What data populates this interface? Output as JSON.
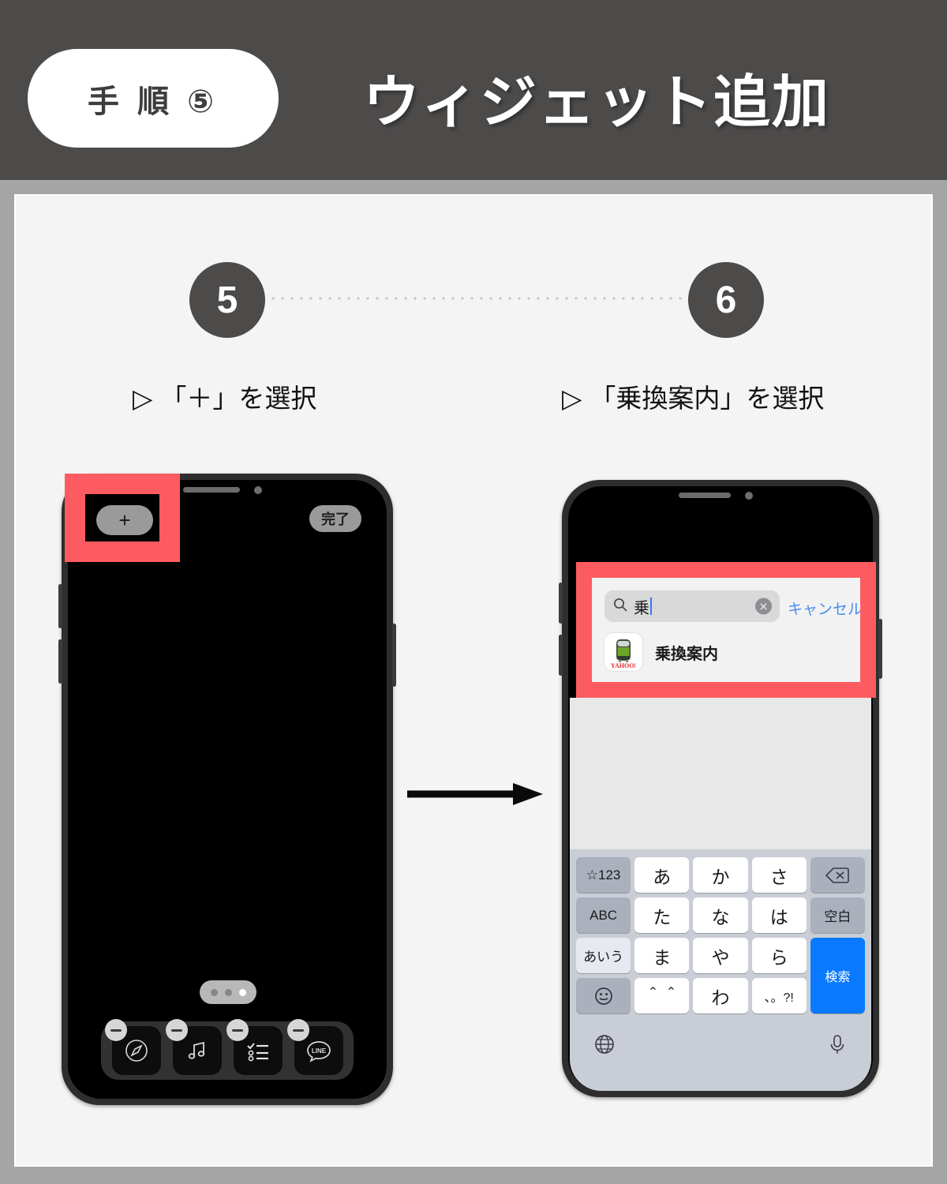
{
  "header": {
    "step_badge": "手 順 ⑤",
    "title": "ウィジェット追加",
    "bg_color": "#4d4b4a",
    "badge_bg": "#ffffff"
  },
  "steps": [
    {
      "number": "5",
      "caption_marker": "▷",
      "caption": "「＋」を選択"
    },
    {
      "number": "6",
      "caption_marker": "▷",
      "caption": "「乗換案内」を選択"
    }
  ],
  "phone1": {
    "add_button_label": "+",
    "done_button_label": "完了",
    "highlight_color": "#fc5c61",
    "page_dots": [
      "inactive",
      "inactive",
      "active"
    ],
    "dock": [
      {
        "name": "Safari",
        "icon": "compass-icon",
        "badge": "minus"
      },
      {
        "name": "ミュージック",
        "icon": "music-note-icon",
        "badge": "minus"
      },
      {
        "name": "リマインダー",
        "icon": "checklist-icon",
        "badge": "minus"
      },
      {
        "name": "LINE",
        "icon": "line-chat-icon",
        "badge": "minus"
      }
    ]
  },
  "phone2": {
    "search": {
      "value": "乗",
      "icon": "search-icon",
      "clear_icon": "clear-circle-icon",
      "cancel_label": "キャンセル",
      "cancel_color": "#4a8df0"
    },
    "results": [
      {
        "label": "乗換案内",
        "icon": "yahoo-transit-app-icon"
      }
    ],
    "highlight_color": "#fc5c61",
    "keyboard": {
      "rows": [
        [
          {
            "label": "☆123",
            "type": "fn"
          },
          {
            "label": "あ",
            "type": "char"
          },
          {
            "label": "か",
            "type": "char"
          },
          {
            "label": "さ",
            "type": "char"
          },
          {
            "label": "⌫",
            "type": "fn",
            "icon": "backspace-icon"
          }
        ],
        [
          {
            "label": "ABC",
            "type": "fn"
          },
          {
            "label": "た",
            "type": "char"
          },
          {
            "label": "な",
            "type": "char"
          },
          {
            "label": "は",
            "type": "char"
          },
          {
            "label": "空白",
            "type": "fn"
          }
        ],
        [
          {
            "label": "あいう",
            "type": "fn-light"
          },
          {
            "label": "ま",
            "type": "char"
          },
          {
            "label": "や",
            "type": "char"
          },
          {
            "label": "ら",
            "type": "char"
          },
          {
            "label": "検索",
            "type": "blue"
          }
        ],
        [
          {
            "label": "☺",
            "type": "fn",
            "icon": "emoji-icon"
          },
          {
            "label": "＾＾",
            "type": "char"
          },
          {
            "label": "わ",
            "type": "char"
          },
          {
            "label": "、。?!",
            "type": "char-small"
          }
        ]
      ],
      "bottom": {
        "globe_icon": "globe-icon",
        "mic_icon": "microphone-icon"
      },
      "search_key_color": "#097aff"
    }
  }
}
